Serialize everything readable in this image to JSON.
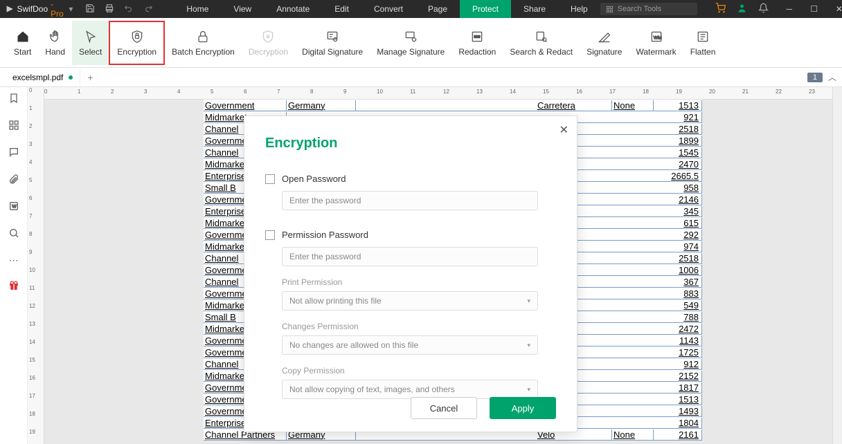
{
  "app": {
    "name_a": "SwifDoo",
    "name_b": "-Pro"
  },
  "menu": [
    "Home",
    "View",
    "Annotate",
    "Edit",
    "Convert",
    "Page",
    "Protect",
    "Share",
    "Help"
  ],
  "menu_active": "Protect",
  "search_placeholder": "Search Tools",
  "ribbon": {
    "start": "Start",
    "hand": "Hand",
    "select": "Select",
    "encryption": "Encryption",
    "batch": "Batch Encryption",
    "decryption": "Decryption",
    "digital_sig": "Digital Signature",
    "manage_sig": "Manage Signature",
    "redaction": "Redaction",
    "search_redact": "Search & Redact",
    "signature": "Signature",
    "watermark": "Watermark",
    "flatten": "Flatten"
  },
  "tab": {
    "name": "excelsmpl.pdf",
    "page": "1"
  },
  "ruler_h": [
    "0",
    "1",
    "2",
    "3",
    "4",
    "5",
    "6",
    "7",
    "8",
    "9",
    "10",
    "11",
    "12",
    "13",
    "14",
    "15",
    "16",
    "17",
    "18",
    "19",
    "20",
    "21",
    "22",
    "23"
  ],
  "ruler_v": [
    "0",
    "1",
    "2",
    "3",
    "4",
    "5",
    "6",
    "7",
    "8",
    "9",
    "10",
    "11",
    "12",
    "13",
    "14",
    "15",
    "16",
    "17",
    "18",
    "19"
  ],
  "rows": [
    {
      "c1": "Government",
      "c2": "Germany",
      "c3": "Carretera",
      "c4": "None",
      "c5": "1513"
    },
    {
      "c1": "Midmarket",
      "c2": "",
      "c3": "",
      "c4": "",
      "c5": "921"
    },
    {
      "c1": "Channel",
      "c2": "",
      "c3": "",
      "c4": "",
      "c5": "2518"
    },
    {
      "c1": "Government",
      "c2": "",
      "c3": "",
      "c4": "",
      "c5": "1899"
    },
    {
      "c1": "Channel",
      "c2": "",
      "c3": "",
      "c4": "",
      "c5": "1545"
    },
    {
      "c1": "Midmarket",
      "c2": "",
      "c3": "",
      "c4": "",
      "c5": "2470"
    },
    {
      "c1": "Enterprise",
      "c2": "",
      "c3": "",
      "c4": "",
      "c5": "2665.5"
    },
    {
      "c1": "Small B",
      "c2": "",
      "c3": "",
      "c4": "",
      "c5": "958"
    },
    {
      "c1": "Government",
      "c2": "",
      "c3": "",
      "c4": "",
      "c5": "2146"
    },
    {
      "c1": "Enterprise",
      "c2": "",
      "c3": "",
      "c4": "",
      "c5": "345"
    },
    {
      "c1": "Midmarket",
      "c2": "",
      "c3": "",
      "c4": "",
      "c5": "615"
    },
    {
      "c1": "Government",
      "c2": "",
      "c3": "",
      "c4": "",
      "c5": "292"
    },
    {
      "c1": "Midmarket",
      "c2": "",
      "c3": "",
      "c4": "",
      "c5": "974"
    },
    {
      "c1": "Channel",
      "c2": "",
      "c3": "",
      "c4": "",
      "c5": "2518"
    },
    {
      "c1": "Government",
      "c2": "",
      "c3": "",
      "c4": "",
      "c5": "1006"
    },
    {
      "c1": "Channel",
      "c2": "",
      "c3": "",
      "c4": "",
      "c5": "367"
    },
    {
      "c1": "Government",
      "c2": "",
      "c3": "",
      "c4": "",
      "c5": "883"
    },
    {
      "c1": "Midmarket",
      "c2": "",
      "c3": "",
      "c4": "",
      "c5": "549"
    },
    {
      "c1": "Small B",
      "c2": "",
      "c3": "",
      "c4": "",
      "c5": "788"
    },
    {
      "c1": "Midmarket",
      "c2": "",
      "c3": "",
      "c4": "",
      "c5": "2472"
    },
    {
      "c1": "Government",
      "c2": "",
      "c3": "",
      "c4": "",
      "c5": "1143"
    },
    {
      "c1": "Government",
      "c2": "",
      "c3": "",
      "c4": "",
      "c5": "1725"
    },
    {
      "c1": "Channel",
      "c2": "",
      "c3": "",
      "c4": "",
      "c5": "912"
    },
    {
      "c1": "Midmarket",
      "c2": "",
      "c3": "",
      "c4": "",
      "c5": "2152"
    },
    {
      "c1": "Government",
      "c2": "",
      "c3": "",
      "c4": "",
      "c5": "1817"
    },
    {
      "c1": "Government",
      "c2": "",
      "c3": "",
      "c4": "",
      "c5": "1513"
    },
    {
      "c1": "Government",
      "c2": "",
      "c3": "",
      "c4": "",
      "c5": "1493"
    },
    {
      "c1": "Enterprise",
      "c2": "",
      "c3": "",
      "c4": "",
      "c5": "1804"
    },
    {
      "c1": "Channel Partners",
      "c2": "Germany",
      "c3": "Velo",
      "c4": "None",
      "c5": "2161"
    }
  ],
  "dialog": {
    "title": "Encryption",
    "open_pw": "Open Password",
    "perm_pw": "Permission Password",
    "pw_placeholder": "Enter the password",
    "print_label": "Print Permission",
    "print_value": "Not allow printing this file",
    "changes_label": "Changes Permission",
    "changes_value": "No changes are allowed on this file",
    "copy_label": "Copy Permission",
    "copy_value": "Not allow copying of text, images, and others",
    "cancel": "Cancel",
    "apply": "Apply"
  }
}
